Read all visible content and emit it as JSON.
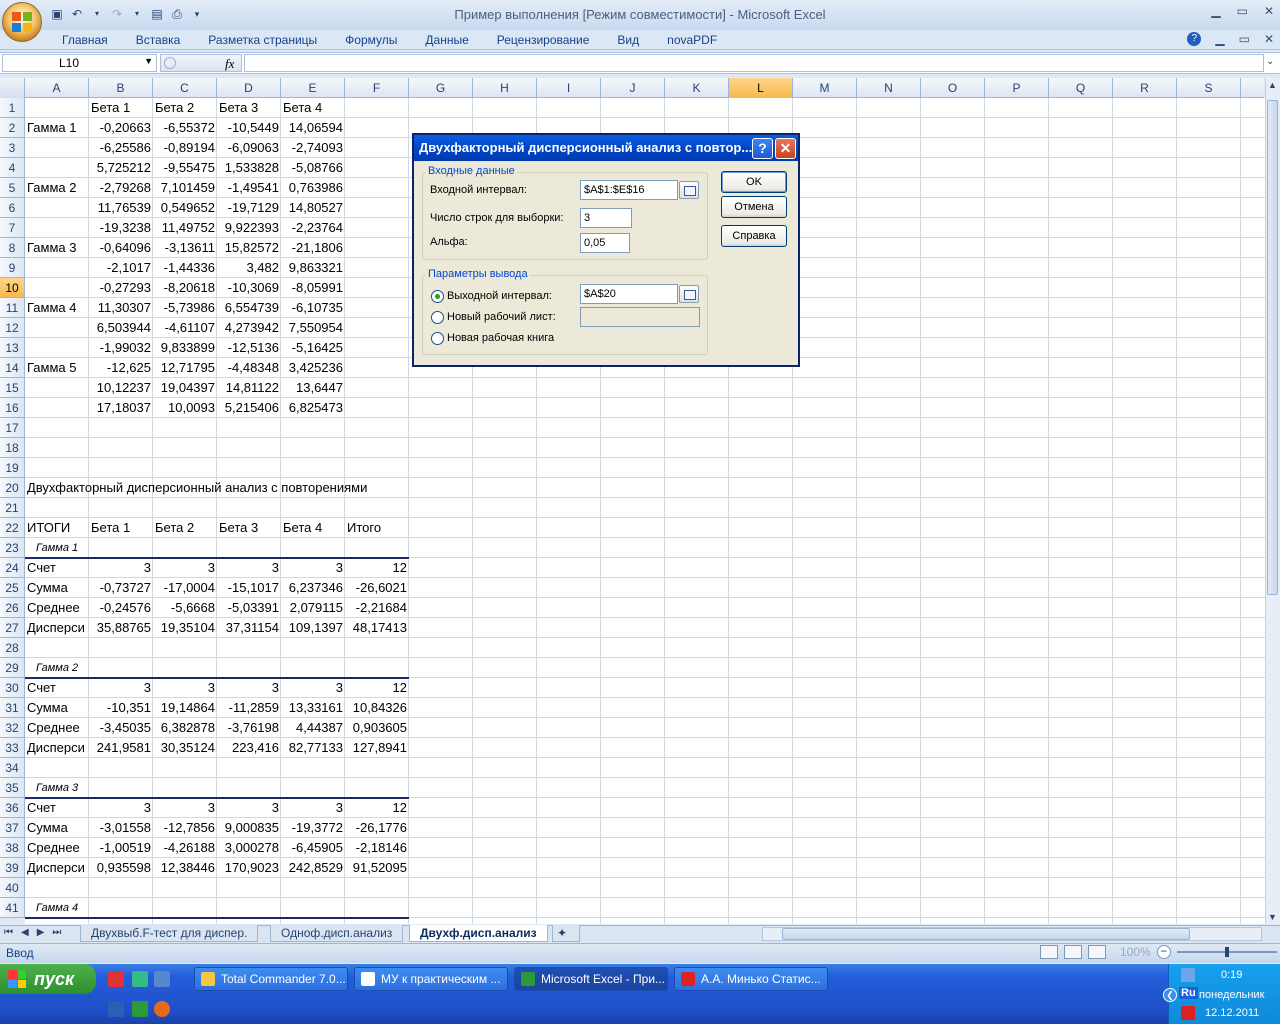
{
  "window": {
    "title": "Пример выполнения  [Режим совместимости] - Microsoft Excel"
  },
  "ribbon": {
    "tabs": [
      "Главная",
      "Вставка",
      "Разметка страницы",
      "Формулы",
      "Данные",
      "Рецензирование",
      "Вид",
      "novaPDF"
    ]
  },
  "formula_bar": {
    "name_box": "L10",
    "fx": "fx",
    "value": ""
  },
  "columns": [
    "A",
    "B",
    "C",
    "D",
    "E",
    "F",
    "G",
    "H",
    "I",
    "J",
    "K",
    "L",
    "M",
    "N",
    "O",
    "P",
    "Q",
    "R",
    "S"
  ],
  "selected_column": "L",
  "selected_row": "10",
  "rows": [
    "1",
    "2",
    "3",
    "4",
    "5",
    "6",
    "7",
    "8",
    "9",
    "10",
    "11",
    "12",
    "13",
    "14",
    "15",
    "16",
    "17",
    "18",
    "19",
    "20",
    "21",
    "22",
    "23",
    "24",
    "25",
    "26",
    "27",
    "28",
    "29",
    "30",
    "31",
    "32",
    "33",
    "34",
    "35",
    "36",
    "37",
    "38",
    "39",
    "40",
    "41"
  ],
  "sheet": {
    "r1": [
      "",
      "Бета 1",
      "Бета 2",
      "Бета 3",
      "Бета 4"
    ],
    "r2": [
      "Гамма 1",
      "-0,20663",
      "-6,55372",
      "-10,5449",
      "14,06594"
    ],
    "r3": [
      "",
      "-6,25586",
      "-0,89194",
      "-6,09063",
      "-2,74093"
    ],
    "r4": [
      "",
      "5,725212",
      "-9,55475",
      "1,533828",
      "-5,08766"
    ],
    "r5": [
      "Гамма 2",
      "-2,79268",
      "7,101459",
      "-1,49541",
      "0,763986"
    ],
    "r6": [
      "",
      "11,76539",
      "0,549652",
      "-19,7129",
      "14,80527"
    ],
    "r7": [
      "",
      "-19,3238",
      "11,49752",
      "9,922393",
      "-2,23764"
    ],
    "r8": [
      "Гамма 3",
      "-0,64096",
      "-3,13611",
      "15,82572",
      "-21,1806"
    ],
    "r9": [
      "",
      "-2,1017",
      "-1,44336",
      "3,482",
      "9,863321"
    ],
    "r10": [
      "",
      "-0,27293",
      "-8,20618",
      "-10,3069",
      "-8,05991"
    ],
    "r11": [
      "Гамма 4",
      "11,30307",
      "-5,73986",
      "6,554739",
      "-6,10735"
    ],
    "r12": [
      "",
      "6,503944",
      "-4,61107",
      "4,273942",
      "7,550954"
    ],
    "r13": [
      "",
      "-1,99032",
      "9,833899",
      "-12,5136",
      "-5,16425"
    ],
    "r14": [
      "Гамма 5",
      "-12,625",
      "12,71795",
      "-4,48348",
      "3,425236"
    ],
    "r15": [
      "",
      "10,12237",
      "19,04397",
      "14,81122",
      "13,6447"
    ],
    "r16": [
      "",
      "17,18037",
      "10,0093",
      "5,215406",
      "6,825473"
    ],
    "r20": "Двухфакторный дисперсионный анализ с повторениями",
    "r22": [
      "ИТОГИ",
      "Бета 1",
      "Бета 2",
      "Бета 3",
      "Бета 4",
      "Итого"
    ],
    "r23": "Гамма 1",
    "r24": [
      "Счет",
      "3",
      "3",
      "3",
      "3",
      "12"
    ],
    "r25": [
      "Сумма",
      "-0,73727",
      "-17,0004",
      "-15,1017",
      "6,237346",
      "-26,6021"
    ],
    "r26": [
      "Среднее",
      "-0,24576",
      "-5,6668",
      "-5,03391",
      "2,079115",
      "-2,21684"
    ],
    "r27": [
      "Дисперси",
      "35,88765",
      "19,35104",
      "37,31154",
      "109,1397",
      "48,17413"
    ],
    "r29": "Гамма 2",
    "r30": [
      "Счет",
      "3",
      "3",
      "3",
      "3",
      "12"
    ],
    "r31": [
      "Сумма",
      "-10,351",
      "19,14864",
      "-11,2859",
      "13,33161",
      "10,84326"
    ],
    "r32": [
      "Среднее",
      "-3,45035",
      "6,382878",
      "-3,76198",
      "4,44387",
      "0,903605"
    ],
    "r33": [
      "Дисперси",
      "241,9581",
      "30,35124",
      "223,416",
      "82,77133",
      "127,8941"
    ],
    "r35": "Гамма 3",
    "r36": [
      "Счет",
      "3",
      "3",
      "3",
      "3",
      "12"
    ],
    "r37": [
      "Сумма",
      "-3,01558",
      "-12,7856",
      "9,000835",
      "-19,3772",
      "-26,1776"
    ],
    "r38": [
      "Среднее",
      "-1,00519",
      "-4,26188",
      "3,000278",
      "-6,45905",
      "-2,18146"
    ],
    "r39": [
      "Дисперси",
      "0,935598",
      "12,38446",
      "170,9023",
      "242,8529",
      "91,52095"
    ],
    "r41": "Гамма 4"
  },
  "sheet_tabs": [
    "Двухвыб.F-тест для диспер.",
    "Одноф.дисп.анализ",
    "Двухф.дисп.анализ"
  ],
  "active_sheet": "Двухф.дисп.анализ",
  "status": {
    "mode": "Ввод",
    "zoom": "100%"
  },
  "dialog": {
    "title": "Двухфакторный дисперсионный анализ с повтор...",
    "input_group": "Входные данные",
    "input_range_label": "Входной интервал:",
    "input_range_value": "$A$1:$E$16",
    "rows_per_sample_label": "Число строк для выборки:",
    "rows_per_sample_value": "3",
    "alpha_label": "Альфа:",
    "alpha_value": "0,05",
    "output_group": "Параметры вывода",
    "output_range_label": "Выходной интервал:",
    "output_range_value": "$A$20",
    "new_sheet_label": "Новый рабочий лист:",
    "new_book_label": "Новая рабочая книга",
    "ok": "OK",
    "cancel": "Отмена",
    "help": "Справка",
    "help_btn": "?",
    "close_btn": "✕"
  },
  "taskbar": {
    "start": "пуск",
    "tasks": [
      "Total Commander 7.0...",
      "МУ к практическим ...",
      "Microsoft Excel - При...",
      "А.А. Минько Статис..."
    ],
    "lang": "Ru",
    "time": "0:19",
    "day": "понедельник",
    "date": "12.12.2011"
  },
  "colors": {
    "accent": "#0a5fe0",
    "grid": "#d0d7e5",
    "selected_header": "#f8b84c"
  }
}
